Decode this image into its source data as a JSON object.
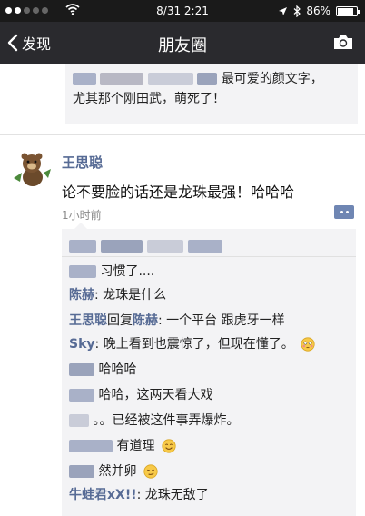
{
  "status_bar": {
    "time": "8/31 2:21",
    "battery": "86%",
    "battery_level": 0.86
  },
  "nav": {
    "back_label": "发现",
    "title": "朋友圈"
  },
  "prev_comment": {
    "text_line1": "最可爱的颜文字，",
    "text_line2": "尤其那个刚田武，萌死了！"
  },
  "post": {
    "author": "王思聪",
    "text": "论不要脸的话还是龙珠最强！哈哈哈",
    "time": "1小时前"
  },
  "comments": [
    {
      "name": "",
      "sep": "",
      "reply_word": "",
      "reply_to": "",
      "text": "习惯了....",
      "emoji": ""
    },
    {
      "name": "陈赫",
      "sep": ": ",
      "reply_word": "",
      "reply_to": "",
      "text": "龙珠是什么",
      "emoji": ""
    },
    {
      "name": "王思聪",
      "sep": ": ",
      "reply_word": "回复",
      "reply_to": "陈赫",
      "text": "一个平台 跟虎牙一样",
      "emoji": ""
    },
    {
      "name": "Sky",
      "sep": ": ",
      "reply_word": "",
      "reply_to": "",
      "text": "晚上看到也震惊了，但现在懂了。",
      "emoji": "flushed-emoji"
    },
    {
      "name": "",
      "sep": "",
      "reply_word": "",
      "reply_to": "",
      "text": "哈哈哈",
      "emoji": ""
    },
    {
      "name": "",
      "sep": "",
      "reply_word": "",
      "reply_to": "",
      "text": "哈哈，这两天看大戏",
      "emoji": ""
    },
    {
      "name": "",
      "sep": "",
      "reply_word": "",
      "reply_to": "",
      "text": "。。已经被这件事弄爆炸。",
      "emoji": ""
    },
    {
      "name": "",
      "sep": "",
      "reply_word": "",
      "reply_to": "",
      "text": "有道理",
      "emoji": "smile-emoji"
    },
    {
      "name": "",
      "sep": "",
      "reply_word": "",
      "reply_to": "",
      "text": "然并卵",
      "emoji": "smirk-emoji"
    },
    {
      "name": "牛蛙君xX!!",
      "sep": ": ",
      "reply_word": "",
      "reply_to": "",
      "text": "龙珠无敌了",
      "emoji": ""
    }
  ],
  "colors": {
    "nav_bg": "#2a2a2e",
    "link_blue": "#576b95",
    "comment_bg": "#f3f3f5"
  }
}
